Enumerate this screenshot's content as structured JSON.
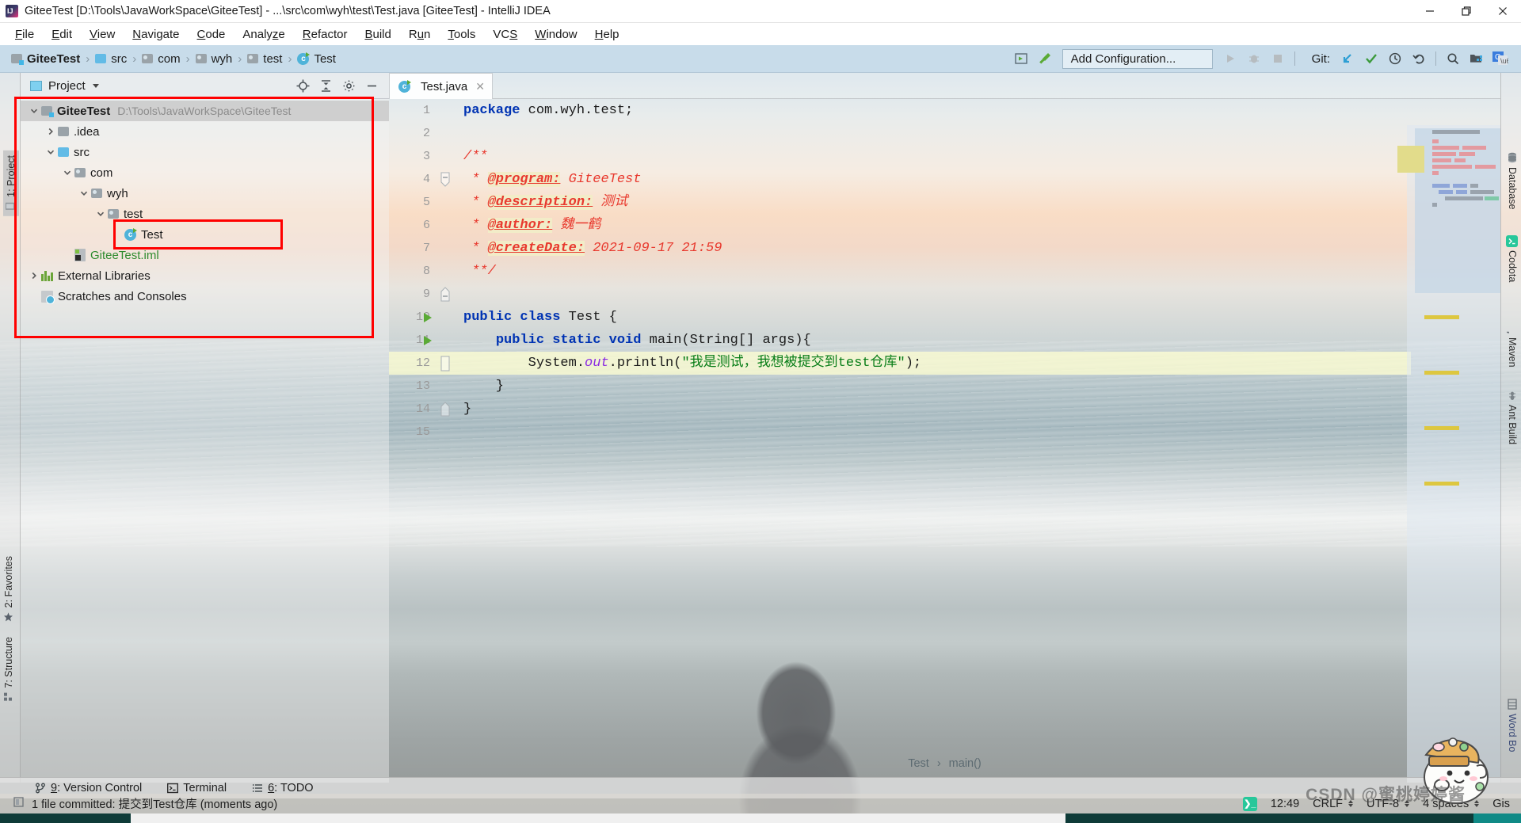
{
  "window": {
    "title": "GiteeTest [D:\\Tools\\JavaWorkSpace\\GiteeTest] - ...\\src\\com\\wyh\\test\\Test.java [GiteeTest] - IntelliJ IDEA",
    "app_icon": "intellij-idea-icon",
    "minimize_label": "—",
    "restore_label": "❐",
    "close_label": "✕"
  },
  "menubar": {
    "items": [
      {
        "label": "File"
      },
      {
        "label": "Edit"
      },
      {
        "label": "View"
      },
      {
        "label": "Navigate"
      },
      {
        "label": "Code"
      },
      {
        "label": "Analyze"
      },
      {
        "label": "Refactor"
      },
      {
        "label": "Build"
      },
      {
        "label": "Run"
      },
      {
        "label": "Tools"
      },
      {
        "label": "VCS"
      },
      {
        "label": "Window"
      },
      {
        "label": "Help"
      }
    ]
  },
  "navbar": {
    "breadcrumbs": [
      {
        "label": "GiteeTest",
        "icon": "module-icon"
      },
      {
        "label": "src",
        "icon": "source-folder-icon"
      },
      {
        "label": "com",
        "icon": "package-icon"
      },
      {
        "label": "wyh",
        "icon": "package-icon"
      },
      {
        "label": "test",
        "icon": "package-icon"
      },
      {
        "label": "Test",
        "icon": "java-class-icon"
      }
    ],
    "separator": "›",
    "config_button": "Add Configuration...",
    "git_label": "Git:",
    "icons": [
      "preview-icon",
      "build-hammer-icon",
      "run-icon",
      "debug-icon",
      "stop-icon",
      "git-update-icon",
      "git-commit-icon",
      "git-history-icon",
      "git-rollback-icon",
      "search-everywhere-icon",
      "project-structure-icon",
      "google-translate-icon"
    ]
  },
  "left_tool_strip": {
    "tabs": [
      {
        "label": "1: Project",
        "icon": "project-icon"
      },
      {
        "label": "2: Favorites",
        "icon": "star-icon"
      },
      {
        "label": "7: Structure",
        "icon": "structure-icon"
      }
    ]
  },
  "right_tool_strip": {
    "tabs": [
      {
        "label": "Database",
        "icon": "database-icon"
      },
      {
        "label": "Codota",
        "icon": "codota-icon"
      },
      {
        "label": "Maven",
        "icon": "maven-icon"
      },
      {
        "label": "Ant Build",
        "icon": "ant-icon"
      },
      {
        "label": "Word Bo",
        "icon": "word-book-icon"
      }
    ]
  },
  "project_panel": {
    "title": "Project",
    "header_icons": [
      "locate-icon",
      "collapse-all-icon",
      "gear-icon",
      "hide-icon"
    ],
    "tree": [
      {
        "label": "GiteeTest",
        "path": "D:\\Tools\\JavaWorkSpace\\GiteeTest",
        "indent": 0,
        "arrow": "down",
        "icon": "module-icon",
        "selected": true,
        "bold": true
      },
      {
        "label": ".idea",
        "path": "",
        "indent": 1,
        "arrow": "right",
        "icon": "folder-icon",
        "selected": false,
        "bold": false
      },
      {
        "label": "src",
        "path": "",
        "indent": 1,
        "arrow": "down",
        "icon": "source-folder-icon",
        "selected": false,
        "bold": false
      },
      {
        "label": "com",
        "path": "",
        "indent": 2,
        "arrow": "down",
        "icon": "package-icon",
        "selected": false,
        "bold": false
      },
      {
        "label": "wyh",
        "path": "",
        "indent": 3,
        "arrow": "down",
        "icon": "package-icon",
        "selected": false,
        "bold": false
      },
      {
        "label": "test",
        "path": "",
        "indent": 4,
        "arrow": "down",
        "icon": "package-icon",
        "selected": false,
        "bold": false
      },
      {
        "label": "Test",
        "path": "",
        "indent": 5,
        "arrow": "none",
        "icon": "java-class-icon",
        "selected": false,
        "bold": false
      },
      {
        "label": "GiteeTest.iml",
        "path": "",
        "indent": 2,
        "arrow": "none",
        "icon": "iml-file-icon",
        "selected": false,
        "bold": false
      },
      {
        "label": "External Libraries",
        "path": "",
        "indent": 0,
        "arrow": "right",
        "icon": "libraries-icon",
        "selected": false,
        "bold": false
      },
      {
        "label": "Scratches and Consoles",
        "path": "",
        "indent": 0,
        "arrow": "none",
        "icon": "scratches-icon",
        "selected": false,
        "bold": false
      }
    ]
  },
  "annotations": {
    "colors": {
      "highlight": "#ff0000"
    },
    "boxes": [
      {
        "name": "project-tree-highlight"
      },
      {
        "name": "test-class-highlight"
      }
    ]
  },
  "editor": {
    "tab": {
      "label": "Test.java",
      "icon": "java-class-icon",
      "close": "✕"
    },
    "breadcrumb": {
      "class": "Test",
      "separator": "›",
      "method": "main()"
    },
    "line_numbers": [
      "1",
      "2",
      "3",
      "4",
      "5",
      "6",
      "7",
      "8",
      "9",
      "10",
      "11",
      "12",
      "13",
      "14",
      "15"
    ],
    "highlighted_line": 12,
    "run_markers": [
      10,
      11
    ],
    "lines": [
      {
        "n": 1,
        "segments": [
          {
            "t": "package",
            "c": "kw"
          },
          {
            "t": " com.wyh.test;",
            "c": "plain"
          }
        ]
      },
      {
        "n": 2,
        "segments": []
      },
      {
        "n": 3,
        "segments": [
          {
            "t": "/**",
            "c": "cmt"
          }
        ]
      },
      {
        "n": 4,
        "segments": [
          {
            "t": " * ",
            "c": "cmt"
          },
          {
            "t": "@program:",
            "c": "tag"
          },
          {
            "t": " GiteeTest",
            "c": "cmt"
          }
        ]
      },
      {
        "n": 5,
        "segments": [
          {
            "t": " * ",
            "c": "cmt"
          },
          {
            "t": "@description:",
            "c": "tag"
          },
          {
            "t": " 测试",
            "c": "cmt"
          }
        ]
      },
      {
        "n": 6,
        "segments": [
          {
            "t": " * ",
            "c": "cmt"
          },
          {
            "t": "@author:",
            "c": "tag"
          },
          {
            "t": " 魏一鹤",
            "c": "cmt"
          }
        ]
      },
      {
        "n": 7,
        "segments": [
          {
            "t": " * ",
            "c": "cmt"
          },
          {
            "t": "@createDate:",
            "c": "tag"
          },
          {
            "t": " 2021-09-17 21:59",
            "c": "cmt"
          }
        ]
      },
      {
        "n": 8,
        "segments": [
          {
            "t": " **/",
            "c": "cmt"
          }
        ]
      },
      {
        "n": 9,
        "segments": []
      },
      {
        "n": 10,
        "segments": [
          {
            "t": "public class",
            "c": "kw"
          },
          {
            "t": " Test {",
            "c": "plain"
          }
        ]
      },
      {
        "n": 11,
        "segments": [
          {
            "t": "    ",
            "c": "plain"
          },
          {
            "t": "public static void",
            "c": "kw"
          },
          {
            "t": " main(String[] args){",
            "c": "plain"
          }
        ]
      },
      {
        "n": 12,
        "segments": [
          {
            "t": "        System.",
            "c": "plain"
          },
          {
            "t": "out",
            "c": "stat"
          },
          {
            "t": ".println(",
            "c": "plain"
          },
          {
            "t": "\"我是测试，我想被提交到test仓库\"",
            "c": "str"
          },
          {
            "t": ");",
            "c": "plain"
          }
        ]
      },
      {
        "n": 13,
        "segments": [
          {
            "t": "    }",
            "c": "plain"
          }
        ]
      },
      {
        "n": 14,
        "segments": [
          {
            "t": "}",
            "c": "plain"
          }
        ]
      },
      {
        "n": 15,
        "segments": []
      }
    ]
  },
  "tool_window_bar": {
    "items": [
      {
        "label": "9: Version Control",
        "icon": "branch-icon"
      },
      {
        "label": "Terminal",
        "icon": "terminal-icon"
      },
      {
        "label": "6: TODO",
        "icon": "todo-icon"
      }
    ]
  },
  "statusbar": {
    "message": "1 file committed: 提交到Test仓库 (moments ago)",
    "message_icon": "notification-icon",
    "codota_icon": "codota-icon",
    "time": "12:49",
    "line_separator": "CRLF",
    "encoding": "UTF-8",
    "indent": "4 spaces",
    "branch": "Gis"
  },
  "watermark": {
    "text": "CSDN @蜜桃婷婷酱"
  }
}
